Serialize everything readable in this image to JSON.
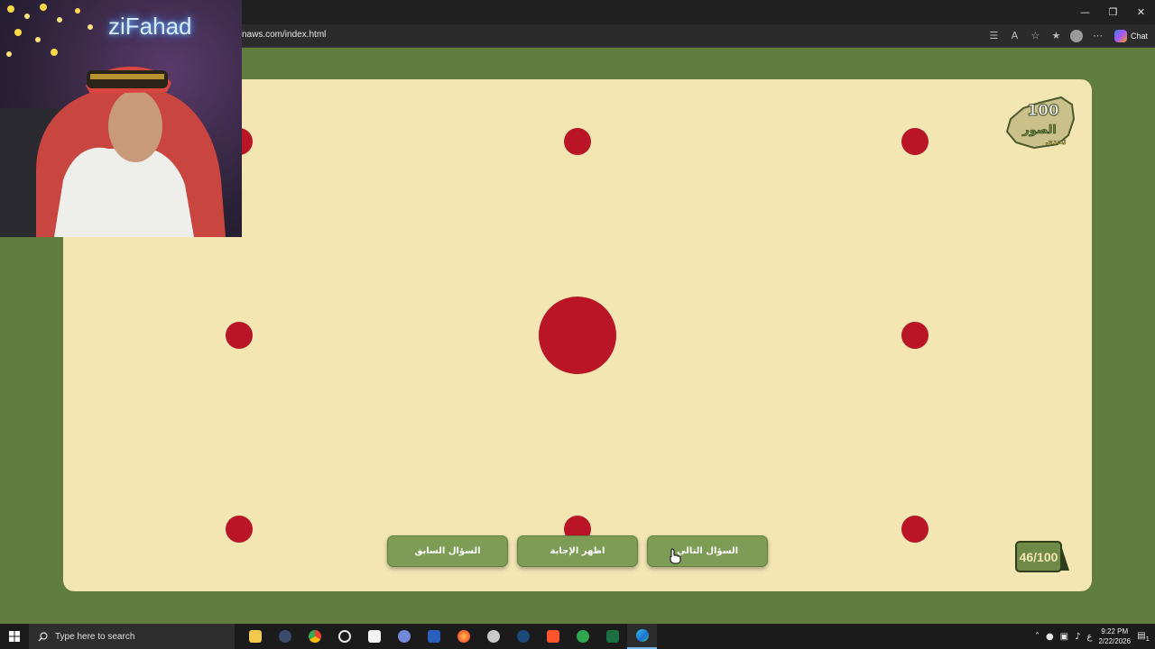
{
  "browser": {
    "url": "naws.com/index.html",
    "chat_label": "Chat",
    "window_controls": [
      "minimize-icon",
      "restore-icon",
      "close-icon"
    ]
  },
  "stream_overlay": {
    "streamer_name": "ziFahad"
  },
  "game": {
    "logo_text": "100 صورة تحدي الصور",
    "counter": "46/100",
    "buttons": {
      "previous": "السؤال السابق",
      "show_answer": "اظهر الإجابة",
      "next": "السؤال التالي"
    },
    "colors": {
      "page_background": "#5f7d3e",
      "board_background": "#f3e6b3",
      "dot": "#b91527",
      "button": "#7d9c55"
    }
  },
  "taskbar": {
    "search_placeholder": "Type here to search",
    "time": "9:22 PM",
    "date": "2/22/2026",
    "input_indicator": "ع",
    "notification_count": "1",
    "pinned_apps": [
      "file-explorer",
      "app",
      "chrome",
      "chatgpt",
      "microsoft-store",
      "discord",
      "word",
      "firefox",
      "app",
      "steam",
      "brave",
      "xbox",
      "excel",
      "edge"
    ]
  }
}
